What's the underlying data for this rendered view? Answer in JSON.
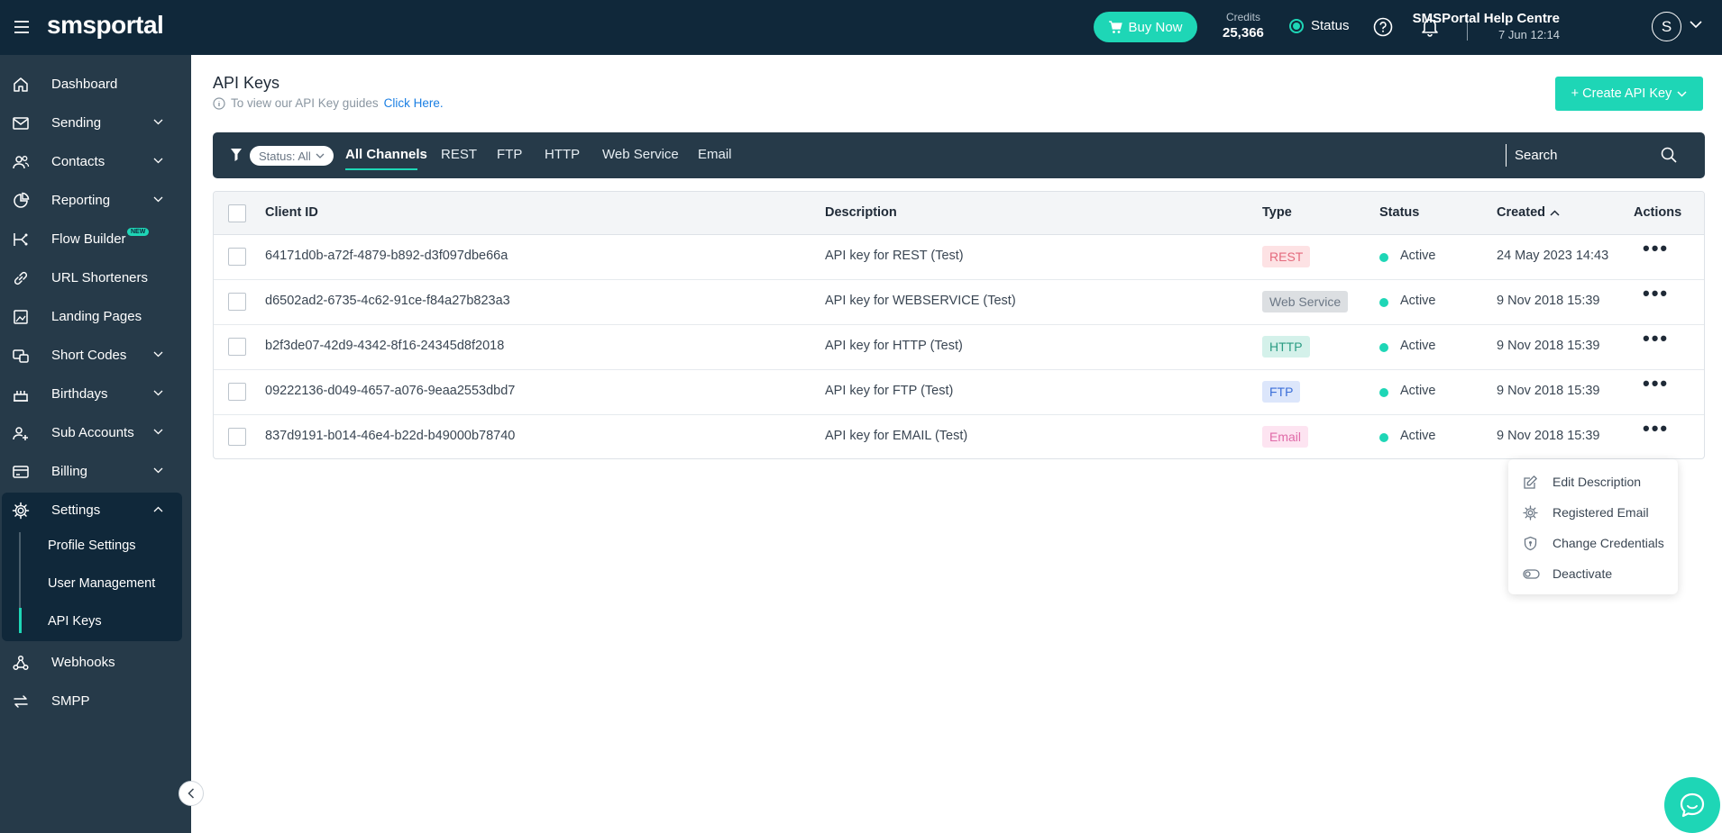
{
  "topbar": {
    "logo": "smsportal",
    "buy_now": "Buy Now",
    "credits_label": "Credits",
    "credits_value": "25,366",
    "status_label": "Status",
    "help_centre": "SMSPortal Help Centre",
    "datetime": "7 Jun 12:14",
    "avatar_initial": "S"
  },
  "sidebar": {
    "items": [
      {
        "label": "Dashboard"
      },
      {
        "label": "Sending"
      },
      {
        "label": "Contacts"
      },
      {
        "label": "Reporting"
      },
      {
        "label": "Flow Builder",
        "badge": "NEW"
      },
      {
        "label": "URL Shorteners"
      },
      {
        "label": "Landing Pages"
      },
      {
        "label": "Short Codes"
      },
      {
        "label": "Birthdays"
      },
      {
        "label": "Sub Accounts"
      },
      {
        "label": "Billing"
      },
      {
        "label": "Settings"
      },
      {
        "label": "Webhooks"
      },
      {
        "label": "SMPP"
      }
    ],
    "settings_sub": [
      {
        "label": "Profile Settings"
      },
      {
        "label": "User Management"
      },
      {
        "label": "API Keys"
      }
    ]
  },
  "page": {
    "title": "API Keys",
    "guide_text": "To view our API Key guides",
    "guide_link": "Click Here.",
    "create_button": "+ Create API Key"
  },
  "filters": {
    "status_pill": "Status: All",
    "tabs": [
      "All Channels",
      "REST",
      "FTP",
      "HTTP",
      "Web Service",
      "Email"
    ],
    "search_placeholder": "Search"
  },
  "table": {
    "headers": {
      "client_id": "Client ID",
      "description": "Description",
      "type": "Type",
      "status": "Status",
      "created": "Created",
      "actions": "Actions"
    },
    "rows": [
      {
        "client_id": "64171d0b-a72f-4879-b892-d3f097dbe66a",
        "description": "API key for REST (Test)",
        "type": "REST",
        "status": "Active",
        "created": "24 May 2023 14:43"
      },
      {
        "client_id": "d6502ad2-6735-4c62-91ce-f84a27b823a3",
        "description": "API key for WEBSERVICE (Test)",
        "type": "Web Service",
        "status": "Active",
        "created": "9 Nov 2018 15:39"
      },
      {
        "client_id": "b2f3de07-42d9-4342-8f16-24345d8f2018",
        "description": "API key for HTTP (Test)",
        "type": "HTTP",
        "status": "Active",
        "created": "9 Nov 2018 15:39"
      },
      {
        "client_id": "09222136-d049-4657-a076-9eaa2553dbd7",
        "description": "API key for FTP (Test)",
        "type": "FTP",
        "status": "Active",
        "created": "9 Nov 2018 15:39"
      },
      {
        "client_id": "837d9191-b014-46e4-b22d-b49000b78740",
        "description": "API key for EMAIL (Test)",
        "type": "Email",
        "status": "Active",
        "created": "9 Nov 2018 15:39"
      }
    ]
  },
  "row_menu": {
    "items": [
      "Edit Description",
      "Registered Email",
      "Change Credentials",
      "Deactivate"
    ]
  },
  "colors": {
    "accent": "#1ed6b6",
    "topbar": "#10283a",
    "sidebar": "#263a49"
  }
}
